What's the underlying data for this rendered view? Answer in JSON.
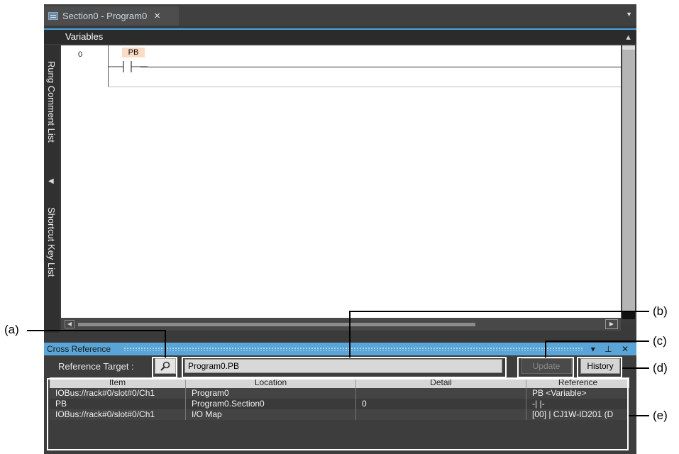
{
  "editor_tab": {
    "title": "Section0 - Program0",
    "close_glyph": "×"
  },
  "variables_bar": {
    "label": "Variables"
  },
  "side_panels": {
    "rung_comment_list": "Rung Comment List",
    "shortcut_key_list": "Shortcut Key List"
  },
  "ladder": {
    "rung_number": "0",
    "contact_variable": "PB"
  },
  "cross_reference": {
    "title": "Cross Reference",
    "window_controls": "▾ ⊥ ✕",
    "reference_target_label": "Reference Target :",
    "reference_target_value": "Program0.PB",
    "update_label": "Update",
    "history_label": "History",
    "columns": [
      "Item",
      "Location",
      "Detail",
      "Reference"
    ],
    "rows": [
      [
        "IOBus://rack#0/slot#0/Ch1",
        "Program0",
        "",
        "PB <Variable>"
      ],
      [
        "PB",
        "Program0.Section0",
        "0",
        "-| |-"
      ],
      [
        "IOBus://rack#0/slot#0/Ch1",
        "I/O Map",
        "",
        "[00] | CJ1W-ID201 (D"
      ]
    ]
  },
  "callouts": {
    "a": "(a)",
    "b": "(b)",
    "c": "(c)",
    "d": "(d)",
    "e": "(e)"
  },
  "colors": {
    "accent_blue": "#5aa5d8",
    "contact_highlight": "#fadcc6",
    "ide_background": "#3a3a3a"
  }
}
